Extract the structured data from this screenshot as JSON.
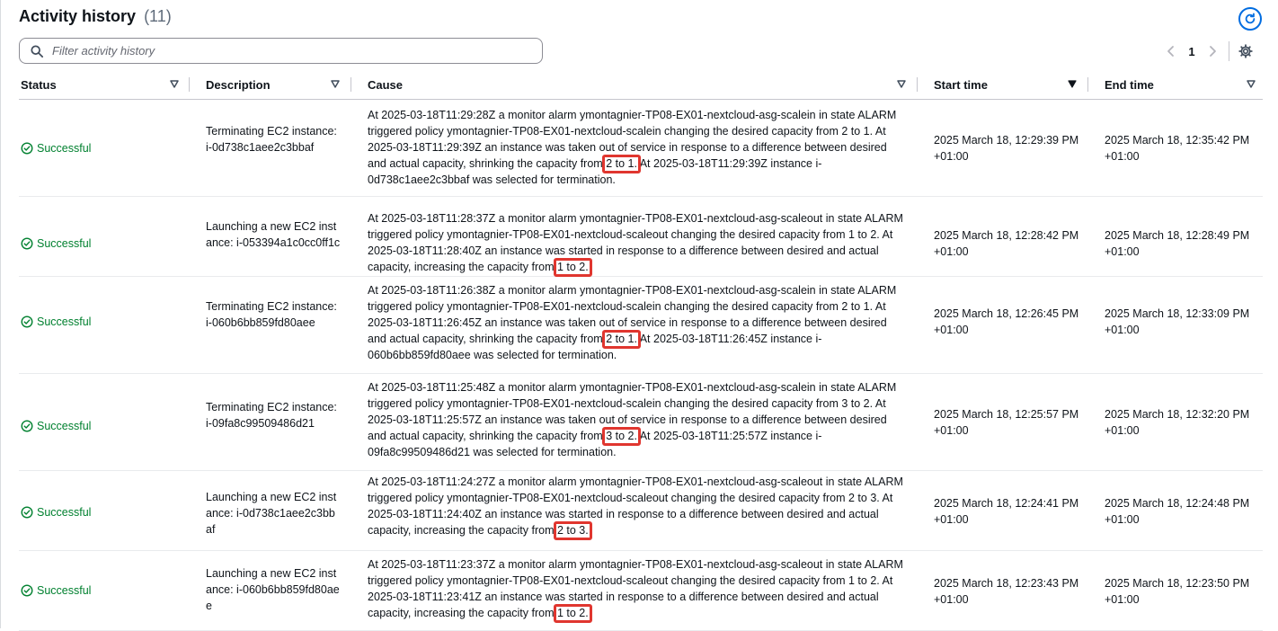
{
  "header": {
    "title": "Activity history",
    "count": "(11)"
  },
  "search": {
    "placeholder": "Filter activity history",
    "value": ""
  },
  "pagination": {
    "current_page": "1"
  },
  "columns": {
    "status": "Status",
    "description": "Description",
    "cause": "Cause",
    "start_time": "Start time",
    "end_time": "End time"
  },
  "rows": [
    {
      "status": "Successful",
      "description": "Terminating EC2 instance: i-0d738c1aee2c3bbaf",
      "cause_pre": "At 2025-03-18T11:29:28Z a monitor alarm ymontagnier-TP08-EX01-nextcloud-asg-scalein in state ALARM triggered policy ymontagnier-TP08-EX01-nextcloud-scalein changing the desired capacity from 2 to 1. At 2025-03-18T11:29:39Z an instance was taken out of service in response to a difference between desired and actual capacity, shrinking the capacity from ",
      "cause_highlight": "2 to 1.",
      "cause_post": " At 2025-03-18T11:29:39Z instance i-0d738c1aee2c3bbaf was selected for termination.",
      "start_time": "2025 March 18, 12:29:39 PM +01:00",
      "end_time": "2025 March 18, 12:35:42 PM +01:00"
    },
    {
      "status": "Successful",
      "description": "Launching a new EC2 instance: i-053394a1c0cc0ff1c",
      "cause_pre": "At 2025-03-18T11:28:37Z a monitor alarm ymontagnier-TP08-EX01-nextcloud-asg-scaleout in state ALARM triggered policy ymontagnier-TP08-EX01-nextcloud-scaleout changing the desired capacity from 1 to 2. At 2025-03-18T11:28:40Z an instance was started in response to a difference between desired and actual capacity, increasing the capacity from ",
      "cause_highlight": "1 to 2.",
      "cause_post": "",
      "start_time": "2025 March 18, 12:28:42 PM +01:00",
      "end_time": "2025 March 18, 12:28:49 PM +01:00"
    },
    {
      "status": "Successful",
      "description": "Terminating EC2 instance: i-060b6bb859fd80aee",
      "cause_pre": "At 2025-03-18T11:26:38Z a monitor alarm ymontagnier-TP08-EX01-nextcloud-asg-scalein in state ALARM triggered policy ymontagnier-TP08-EX01-nextcloud-scalein changing the desired capacity from 2 to 1. At 2025-03-18T11:26:45Z an instance was taken out of service in response to a difference between desired and actual capacity, shrinking the capacity from ",
      "cause_highlight": "2 to 1.",
      "cause_post": " At 2025-03-18T11:26:45Z instance i-060b6bb859fd80aee was selected for termination.",
      "start_time": "2025 March 18, 12:26:45 PM +01:00",
      "end_time": "2025 March 18, 12:33:09 PM +01:00"
    },
    {
      "status": "Successful",
      "description": "Terminating EC2 instance: i-09fa8c99509486d21",
      "cause_pre": "At 2025-03-18T11:25:48Z a monitor alarm ymontagnier-TP08-EX01-nextcloud-asg-scalein in state ALARM triggered policy ymontagnier-TP08-EX01-nextcloud-scalein changing the desired capacity from 3 to 2. At 2025-03-18T11:25:57Z an instance was taken out of service in response to a difference between desired and actual capacity, shrinking the capacity from ",
      "cause_highlight": "3 to 2.",
      "cause_post": " At 2025-03-18T11:25:57Z instance i-09fa8c99509486d21 was selected for termination.",
      "start_time": "2025 March 18, 12:25:57 PM +01:00",
      "end_time": "2025 March 18, 12:32:20 PM +01:00"
    },
    {
      "status": "Successful",
      "description": "Launching a new EC2 instance: i-0d738c1aee2c3bbaf",
      "cause_pre": "At 2025-03-18T11:24:27Z a monitor alarm ymontagnier-TP08-EX01-nextcloud-asg-scaleout in state ALARM triggered policy ymontagnier-TP08-EX01-nextcloud-scaleout changing the desired capacity from 2 to 3. At 2025-03-18T11:24:40Z an instance was started in response to a difference between desired and actual capacity, increasing the capacity from ",
      "cause_highlight": "2 to 3.",
      "cause_post": "",
      "start_time": "2025 March 18, 12:24:41 PM +01:00",
      "end_time": "2025 March 18, 12:24:48 PM +01:00"
    },
    {
      "status": "Successful",
      "description": "Launching a new EC2 instance: i-060b6bb859fd80aee",
      "cause_pre": "At 2025-03-18T11:23:37Z a monitor alarm ymontagnier-TP08-EX01-nextcloud-asg-scaleout in state ALARM triggered policy ymontagnier-TP08-EX01-nextcloud-scaleout changing the desired capacity from 1 to 2. At 2025-03-18T11:23:41Z an instance was started in response to a difference between desired and actual capacity, increasing the capacity from ",
      "cause_highlight": "1 to 2.",
      "cause_post": "",
      "start_time": "2025 March 18, 12:23:43 PM +01:00",
      "end_time": "2025 March 18, 12:23:50 PM +01:00"
    }
  ],
  "colors": {
    "success": "#00802f",
    "highlight_box": "#e0362f",
    "link_blue": "#006ce0"
  },
  "icons": {
    "refresh": "refresh-icon",
    "search": "search-icon",
    "status": "check-circle-icon",
    "settings": "gear-icon"
  }
}
